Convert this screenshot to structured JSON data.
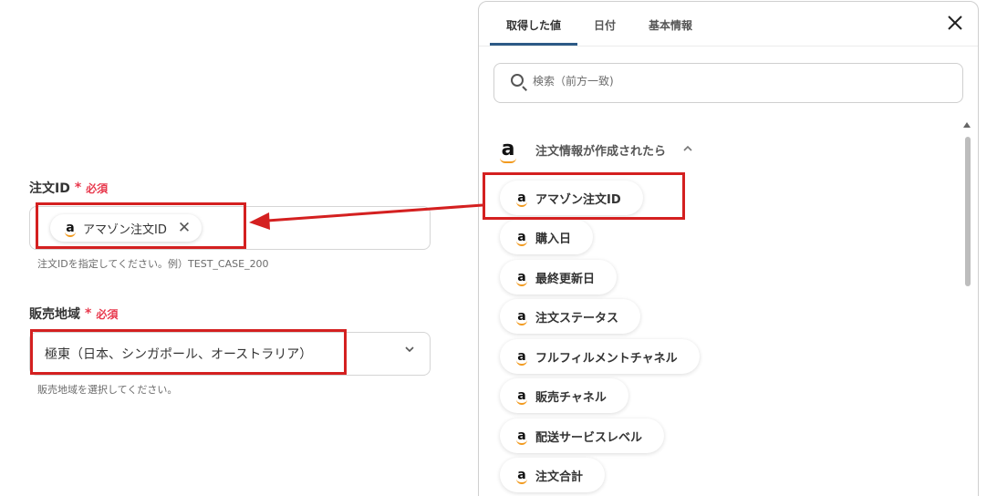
{
  "form": {
    "order_id": {
      "label": "注文ID",
      "required_star": "*",
      "required_text": "必須",
      "chip_label": "アマゾン注文ID",
      "chip_remove": "✕",
      "hint": "注文IDを指定してください。例）TEST_CASE_200"
    },
    "region": {
      "label": "販売地域",
      "required_star": "*",
      "required_text": "必須",
      "value": "極東（日本、シンガポール、オーストラリア）",
      "hint": "販売地域を選択してください。"
    }
  },
  "panel": {
    "tabs": [
      {
        "label": "取得した値",
        "active": true
      },
      {
        "label": "日付",
        "active": false
      },
      {
        "label": "基本情報",
        "active": false
      }
    ],
    "close_icon": "✕",
    "search_placeholder": "検索（前方一致)",
    "group": {
      "title": "注文情報が作成されたら",
      "caret": "^",
      "logo_letter": "a"
    },
    "items": [
      "アマゾン注文ID",
      "購入日",
      "最終更新日",
      "注文ステータス",
      "フルフィルメントチャネル",
      "販売チャネル",
      "配送サービスレベル",
      "注文合計"
    ]
  },
  "colors": {
    "highlight_red": "#d42020",
    "required_red": "#e8394d",
    "active_tab_underline": "#2d5a86",
    "amazon_orange": "#f29a1e"
  },
  "icons": {
    "amazon": "amazon-logo-icon",
    "search": "search-icon",
    "close": "close-icon",
    "chevron": "chevron-down-icon"
  }
}
